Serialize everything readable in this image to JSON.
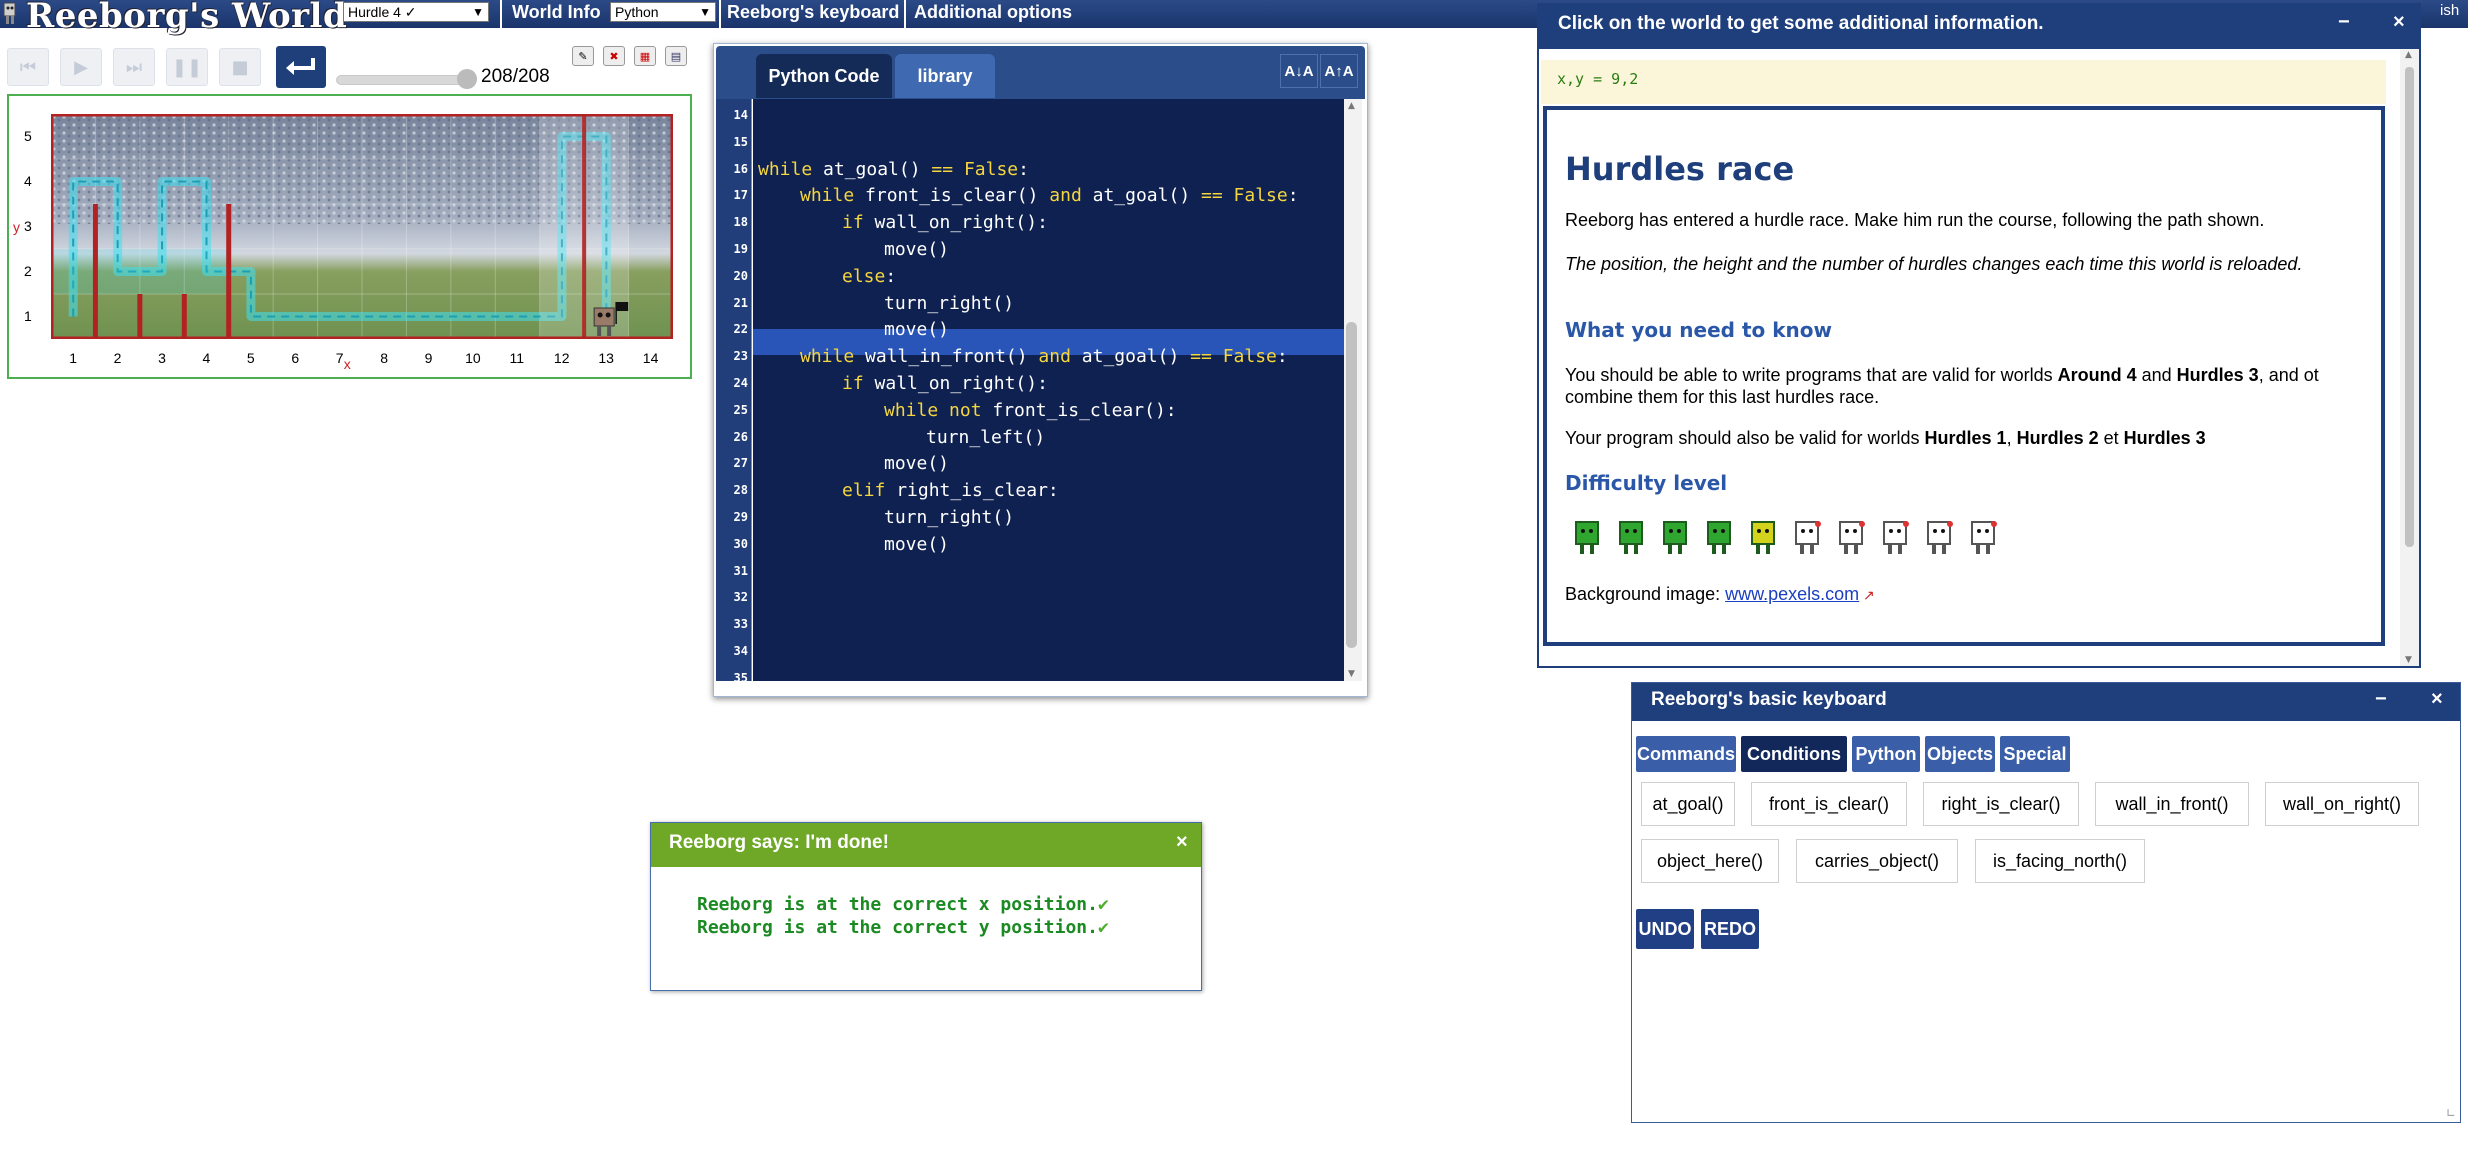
{
  "topbar": {
    "app_title": "Reeborg's World",
    "world_select": "Hurdle 4 ✓",
    "world_info": "World Info",
    "language_select": "Python",
    "keyboard": "Reeborg's keyboard",
    "additional_options": "Additional options",
    "lang_tail": "ish"
  },
  "controls": {
    "step_count": "208/208"
  },
  "world": {
    "y_axis_label": "y",
    "x_axis_label": "x",
    "rows": [
      "5",
      "4",
      "3",
      "2",
      "1"
    ],
    "columns": [
      "1",
      "2",
      "3",
      "4",
      "5",
      "6",
      "7",
      "8",
      "9",
      "10",
      "11",
      "12",
      "13",
      "14"
    ]
  },
  "editor": {
    "tab_python": "Python Code",
    "tab_library": "library",
    "font_decrease": "A↓A",
    "font_increase": "A↑A",
    "lines": [
      {
        "n": "14",
        "indent": 0,
        "parts": []
      },
      {
        "n": "15",
        "indent": 0,
        "parts": []
      },
      {
        "n": "16",
        "indent": 0,
        "parts": [
          {
            "k": 1,
            "t": "while"
          },
          {
            "k": 0,
            "t": " at_goal() "
          },
          {
            "k": 1,
            "t": "=="
          },
          {
            "k": 0,
            "t": " "
          },
          {
            "k": 1,
            "t": "False"
          },
          {
            "k": 0,
            "t": ":"
          }
        ]
      },
      {
        "n": "17",
        "indent": 1,
        "parts": [
          {
            "k": 1,
            "t": "while"
          },
          {
            "k": 0,
            "t": " front_is_clear() "
          },
          {
            "k": 1,
            "t": "and"
          },
          {
            "k": 0,
            "t": " at_goal() "
          },
          {
            "k": 1,
            "t": "=="
          },
          {
            "k": 0,
            "t": " "
          },
          {
            "k": 1,
            "t": "False"
          },
          {
            "k": 0,
            "t": ":"
          }
        ]
      },
      {
        "n": "18",
        "indent": 2,
        "parts": [
          {
            "k": 1,
            "t": "if"
          },
          {
            "k": 0,
            "t": " wall_on_right():"
          }
        ]
      },
      {
        "n": "19",
        "indent": 3,
        "parts": [
          {
            "k": 0,
            "t": "move()"
          }
        ]
      },
      {
        "n": "20",
        "indent": 2,
        "parts": [
          {
            "k": 1,
            "t": "else"
          },
          {
            "k": 0,
            "t": ":"
          }
        ]
      },
      {
        "n": "21",
        "indent": 3,
        "parts": [
          {
            "k": 0,
            "t": "turn_right()"
          }
        ]
      },
      {
        "n": "22",
        "indent": 3,
        "parts": [
          {
            "k": 0,
            "t": "move()"
          }
        ]
      },
      {
        "n": "23",
        "indent": 1,
        "parts": [
          {
            "k": 1,
            "t": "while"
          },
          {
            "k": 0,
            "t": " wall_in_front() "
          },
          {
            "k": 1,
            "t": "and"
          },
          {
            "k": 0,
            "t": " at_goal() "
          },
          {
            "k": 1,
            "t": "=="
          },
          {
            "k": 0,
            "t": " "
          },
          {
            "k": 1,
            "t": "False"
          },
          {
            "k": 0,
            "t": ":"
          }
        ]
      },
      {
        "n": "24",
        "indent": 2,
        "parts": [
          {
            "k": 1,
            "t": "if"
          },
          {
            "k": 0,
            "t": " wall_on_right():"
          }
        ]
      },
      {
        "n": "25",
        "indent": 3,
        "parts": [
          {
            "k": 1,
            "t": "while not"
          },
          {
            "k": 0,
            "t": " front_is_clear():"
          }
        ]
      },
      {
        "n": "26",
        "indent": 4,
        "parts": [
          {
            "k": 0,
            "t": "turn_left()"
          }
        ]
      },
      {
        "n": "27",
        "indent": 3,
        "parts": [
          {
            "k": 0,
            "t": "move()"
          }
        ]
      },
      {
        "n": "28",
        "indent": 2,
        "parts": [
          {
            "k": 1,
            "t": "elif"
          },
          {
            "k": 0,
            "t": " right_is_clear:"
          }
        ]
      },
      {
        "n": "29",
        "indent": 3,
        "parts": [
          {
            "k": 0,
            "t": "turn_right()"
          }
        ]
      },
      {
        "n": "30",
        "indent": 3,
        "parts": [
          {
            "k": 0,
            "t": "move()"
          }
        ]
      },
      {
        "n": "31",
        "indent": 0,
        "parts": []
      },
      {
        "n": "32",
        "indent": 0,
        "parts": []
      },
      {
        "n": "33",
        "indent": 0,
        "parts": []
      },
      {
        "n": "34",
        "indent": 0,
        "parts": []
      },
      {
        "n": "35",
        "indent": 0,
        "parts": []
      }
    ]
  },
  "info": {
    "header": "Click on the world to get some additional information.",
    "minimize": "−",
    "close": "×",
    "coords": "x,y = 9,2",
    "title": "Hurdles race",
    "p1": "Reeborg has entered a hurdle race. Make him run the course, following the path shown.",
    "p2": "The position, the height and the number of hurdles changes each time this world is reloaded.",
    "h_need": "What you need to know",
    "p3_pre": "You should be able to write programs that are valid for worlds ",
    "p3_b1": "Around 4",
    "p3_mid": " and ",
    "p3_b2": "Hurdles 3",
    "p3_post": ", and ot combine them for this last hurdles race.",
    "p4_pre": "Your program should also be valid for worlds ",
    "p4_b1": "Hurdles 1",
    "p4_sep": ", ",
    "p4_b2": "Hurdles 2",
    "p4_et": " et ",
    "p4_b3": "Hurdles 3",
    "h_diff": "Difficulty level",
    "difficulty_level": 5,
    "difficulty_max": 10,
    "bg_label": "Background image: ",
    "bg_link": "www.pexels.com"
  },
  "done": {
    "title": "Reeborg says: I'm done!",
    "close": "×",
    "line1": "Reeborg is at the correct x position.",
    "line2": "Reeborg is at the correct y position."
  },
  "keyboard": {
    "title": "Reeborg's basic keyboard",
    "minimize": "−",
    "close": "×",
    "tabs": [
      "Commands",
      "Conditions",
      "Python",
      "Objects",
      "Special"
    ],
    "active_tab": "Conditions",
    "row1": [
      "at_goal()",
      "front_is_clear()",
      "right_is_clear()",
      "wall_in_front()",
      "wall_on_right()"
    ],
    "row2": [
      "object_here()",
      "carries_object()",
      "is_facing_north()"
    ],
    "undo": "UNDO",
    "redo": "REDO"
  },
  "colors": {
    "nav_blue": "#1e3e7c",
    "editor_bg": "#0f2150",
    "keyword": "#f5d63d",
    "success_green": "#6fa727",
    "world_wall": "#b22222",
    "path_cyan": "#3fe0f0"
  }
}
